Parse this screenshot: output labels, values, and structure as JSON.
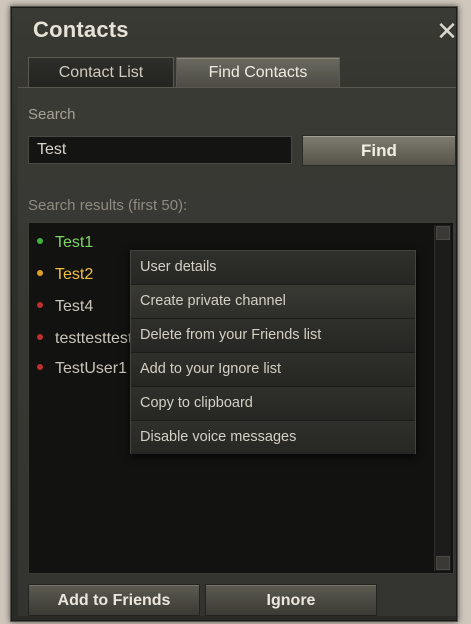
{
  "window": {
    "title": "Contacts",
    "close_icon": "close-icon"
  },
  "tabs": [
    {
      "label": "Contact List",
      "active": false
    },
    {
      "label": "Find Contacts",
      "active": true
    }
  ],
  "search": {
    "label": "Search",
    "value": "Test",
    "button_label": "Find"
  },
  "results": {
    "label": "Search results (first 50):",
    "items": [
      {
        "name": "Test1",
        "status_color": "#3fb43f",
        "text_color": "#7fd36a"
      },
      {
        "name": "Test2",
        "status_color": "#e0a020",
        "text_color": "#f0c040"
      },
      {
        "name": "Test4",
        "status_color": "#c03030",
        "text_color": "#c9c5ba"
      },
      {
        "name": "testtesttest",
        "status_color": "#c03030",
        "text_color": "#c9c5ba"
      },
      {
        "name": "TestUser1",
        "status_color": "#c03030",
        "text_color": "#c9c5ba"
      }
    ]
  },
  "context_menu": {
    "items": [
      {
        "label": "User details"
      },
      {
        "label": "Create private channel"
      },
      {
        "label": "Delete from your Friends list"
      },
      {
        "label": "Add to your Ignore list"
      },
      {
        "label": "Copy to clipboard"
      },
      {
        "label": "Disable voice messages"
      }
    ]
  },
  "buttons": {
    "add_friends": "Add to Friends",
    "ignore": "Ignore"
  }
}
